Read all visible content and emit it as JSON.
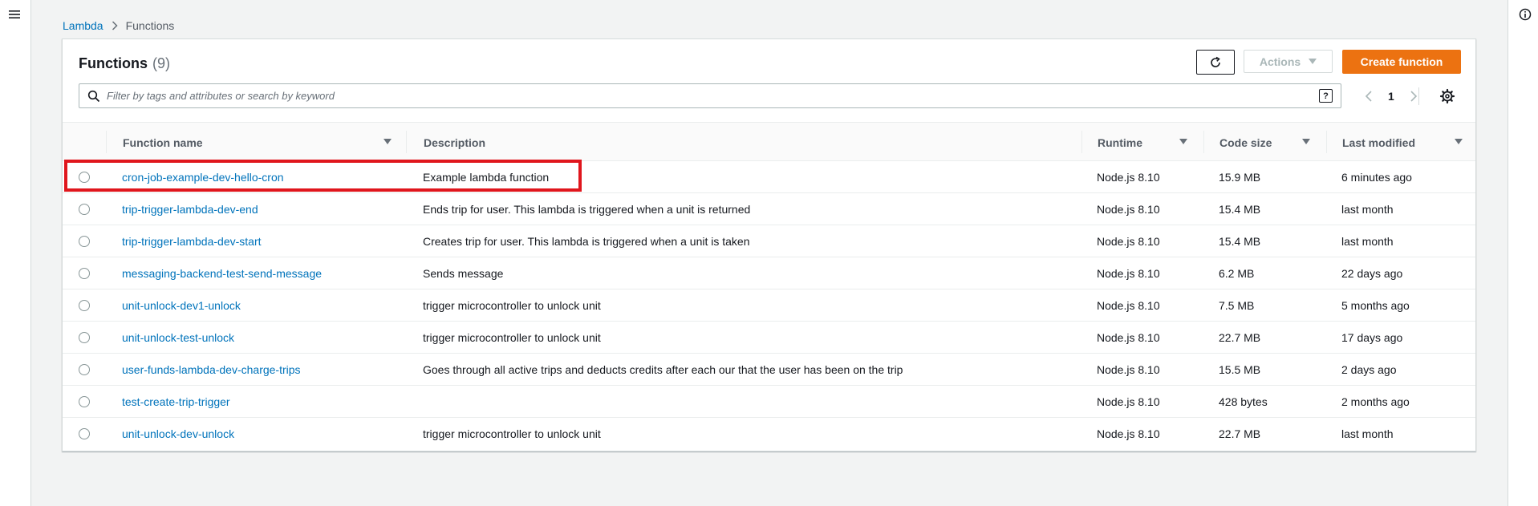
{
  "breadcrumb": {
    "root": "Lambda",
    "current": "Functions"
  },
  "panel": {
    "title": "Functions",
    "count": "(9)"
  },
  "toolbar": {
    "refresh_icon": "refresh-icon",
    "actions_label": "Actions",
    "create_label": "Create function"
  },
  "search": {
    "placeholder": "Filter by tags and attributes or search by keyword",
    "help_label": "?"
  },
  "pagination": {
    "current_page": "1"
  },
  "columns": {
    "name": "Function name",
    "description": "Description",
    "runtime": "Runtime",
    "code_size": "Code size",
    "last_modified": "Last modified"
  },
  "rows": [
    {
      "name": "cron-job-example-dev-hello-cron",
      "description": "Example lambda function",
      "runtime": "Node.js 8.10",
      "code_size": "15.9 MB",
      "last_modified": "6 minutes ago"
    },
    {
      "name": "trip-trigger-lambda-dev-end",
      "description": "Ends trip for user. This lambda is triggered when a unit is returned",
      "runtime": "Node.js 8.10",
      "code_size": "15.4 MB",
      "last_modified": "last month"
    },
    {
      "name": "trip-trigger-lambda-dev-start",
      "description": "Creates trip for user. This lambda is triggered when a unit is taken",
      "runtime": "Node.js 8.10",
      "code_size": "15.4 MB",
      "last_modified": "last month"
    },
    {
      "name": "messaging-backend-test-send-message",
      "description": "Sends message",
      "runtime": "Node.js 8.10",
      "code_size": "6.2 MB",
      "last_modified": "22 days ago"
    },
    {
      "name": "unit-unlock-dev1-unlock",
      "description": "trigger microcontroller to unlock unit",
      "runtime": "Node.js 8.10",
      "code_size": "7.5 MB",
      "last_modified": "5 months ago"
    },
    {
      "name": "unit-unlock-test-unlock",
      "description": "trigger microcontroller to unlock unit",
      "runtime": "Node.js 8.10",
      "code_size": "22.7 MB",
      "last_modified": "17 days ago"
    },
    {
      "name": "user-funds-lambda-dev-charge-trips",
      "description": "Goes through all active trips and deducts credits after each our that the user has been on the trip",
      "runtime": "Node.js 8.10",
      "code_size": "15.5 MB",
      "last_modified": "2 days ago"
    },
    {
      "name": "test-create-trip-trigger",
      "description": "",
      "runtime": "Node.js 8.10",
      "code_size": "428 bytes",
      "last_modified": "2 months ago"
    },
    {
      "name": "unit-unlock-dev-unlock",
      "description": "trigger microcontroller to unlock unit",
      "runtime": "Node.js 8.10",
      "code_size": "22.7 MB",
      "last_modified": "last month"
    }
  ],
  "colors": {
    "link": "#0073bb",
    "primary_button": "#ec7211",
    "highlight": "#e0161d",
    "background": "#f2f3f3"
  }
}
